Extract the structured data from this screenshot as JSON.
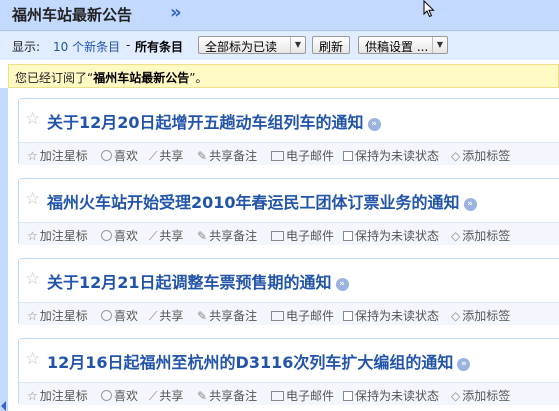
{
  "header": {
    "title": "福州车站最新公告",
    "arrow": "»"
  },
  "toolbar": {
    "show_label": "显示:",
    "new_items": "10 个新条目",
    "separator": "-",
    "all_items": "所有条目",
    "mark_all_read": "全部标为已读",
    "refresh": "刷新",
    "feed_settings": "供稿设置 ..."
  },
  "notice": {
    "prefix": "您已经订阅了“",
    "feed_name": "福州车站最新公告",
    "suffix": "”。"
  },
  "entries": [
    {
      "title": "关于12月20日起增开五趟动车组列车的通知"
    },
    {
      "title": "福州火车站开始受理2010年春运民工团体订票业务的通知"
    },
    {
      "title": "关于12月21日起调整车票预售期的通知"
    },
    {
      "title": "12月16日起福州至杭州的D3116次列车扩大编组的通知"
    }
  ],
  "actions": {
    "add_star": "加注星标",
    "like": "喜欢",
    "share": "共享",
    "share_with_note": "共享备注",
    "email": "电子邮件",
    "keep_unread": "保持为未读状态",
    "add_tags": "添加标签"
  },
  "colors": {
    "header_bg": "#c3d9ff",
    "toolbar_bg": "#e0ecff",
    "notice_bg": "#fff9c4",
    "link": "#2255aa"
  }
}
